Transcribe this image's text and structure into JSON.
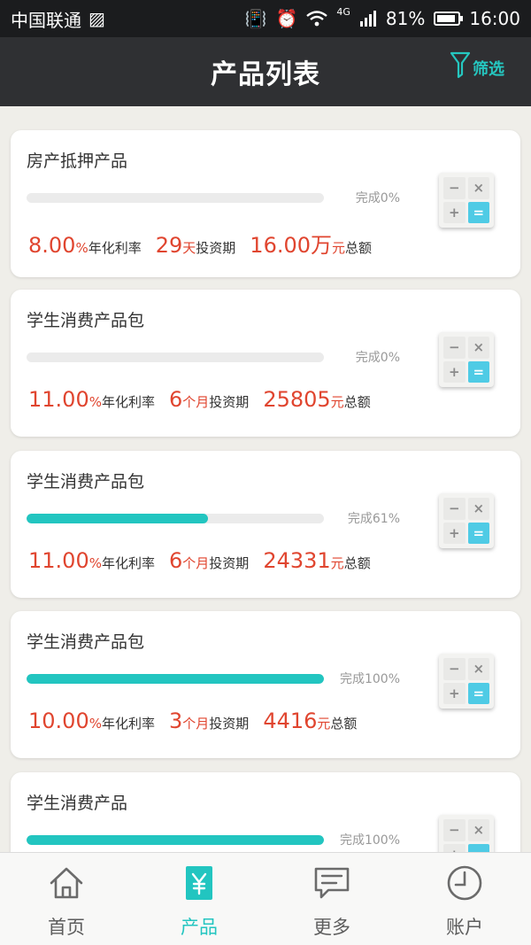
{
  "status_bar": {
    "carrier": "中国联通",
    "network": "4G",
    "battery": "81%",
    "time": "16:00"
  },
  "header": {
    "title": "产品列表",
    "filter_label": "筛选"
  },
  "products": [
    {
      "name": "房产抵押产品",
      "progress": 0,
      "status_text": "完成0%",
      "rate": "8.00",
      "rate_unit": "%",
      "rate_label": "年化利率",
      "term": "29",
      "term_unit": "天",
      "term_label": "投资期",
      "amount": "16.00万",
      "amount_unit": "元",
      "amount_label": "总额"
    },
    {
      "name": "学生消费产品包",
      "progress": 0,
      "status_text": "完成0%",
      "rate": "11.00",
      "rate_unit": "%",
      "rate_label": "年化利率",
      "term": "6",
      "term_unit": "个月",
      "term_label": "投资期",
      "amount": "25805",
      "amount_unit": "元",
      "amount_label": "总额"
    },
    {
      "name": "学生消费产品包",
      "progress": 61,
      "status_text": "完成61%",
      "rate": "11.00",
      "rate_unit": "%",
      "rate_label": "年化利率",
      "term": "6",
      "term_unit": "个月",
      "term_label": "投资期",
      "amount": "24331",
      "amount_unit": "元",
      "amount_label": "总额"
    },
    {
      "name": "学生消费产品包",
      "progress": 100,
      "status_text": "完成100%",
      "rate": "10.00",
      "rate_unit": "%",
      "rate_label": "年化利率",
      "term": "3",
      "term_unit": "个月",
      "term_label": "投资期",
      "amount": "4416",
      "amount_unit": "元",
      "amount_label": "总额"
    },
    {
      "name": "学生消费产品",
      "progress": 100,
      "status_text": "完成100%"
    }
  ],
  "calculator_keys": [
    "−",
    "×",
    "+",
    "="
  ],
  "tabs": [
    {
      "label": "首页",
      "icon": "home-icon"
    },
    {
      "label": "产品",
      "icon": "yen-icon"
    },
    {
      "label": "更多",
      "icon": "message-icon"
    },
    {
      "label": "账户",
      "icon": "clock-icon"
    }
  ],
  "colors": {
    "accent": "#22c5c0",
    "rate_red": "#e0452f",
    "header_bg": "#2f3033"
  }
}
